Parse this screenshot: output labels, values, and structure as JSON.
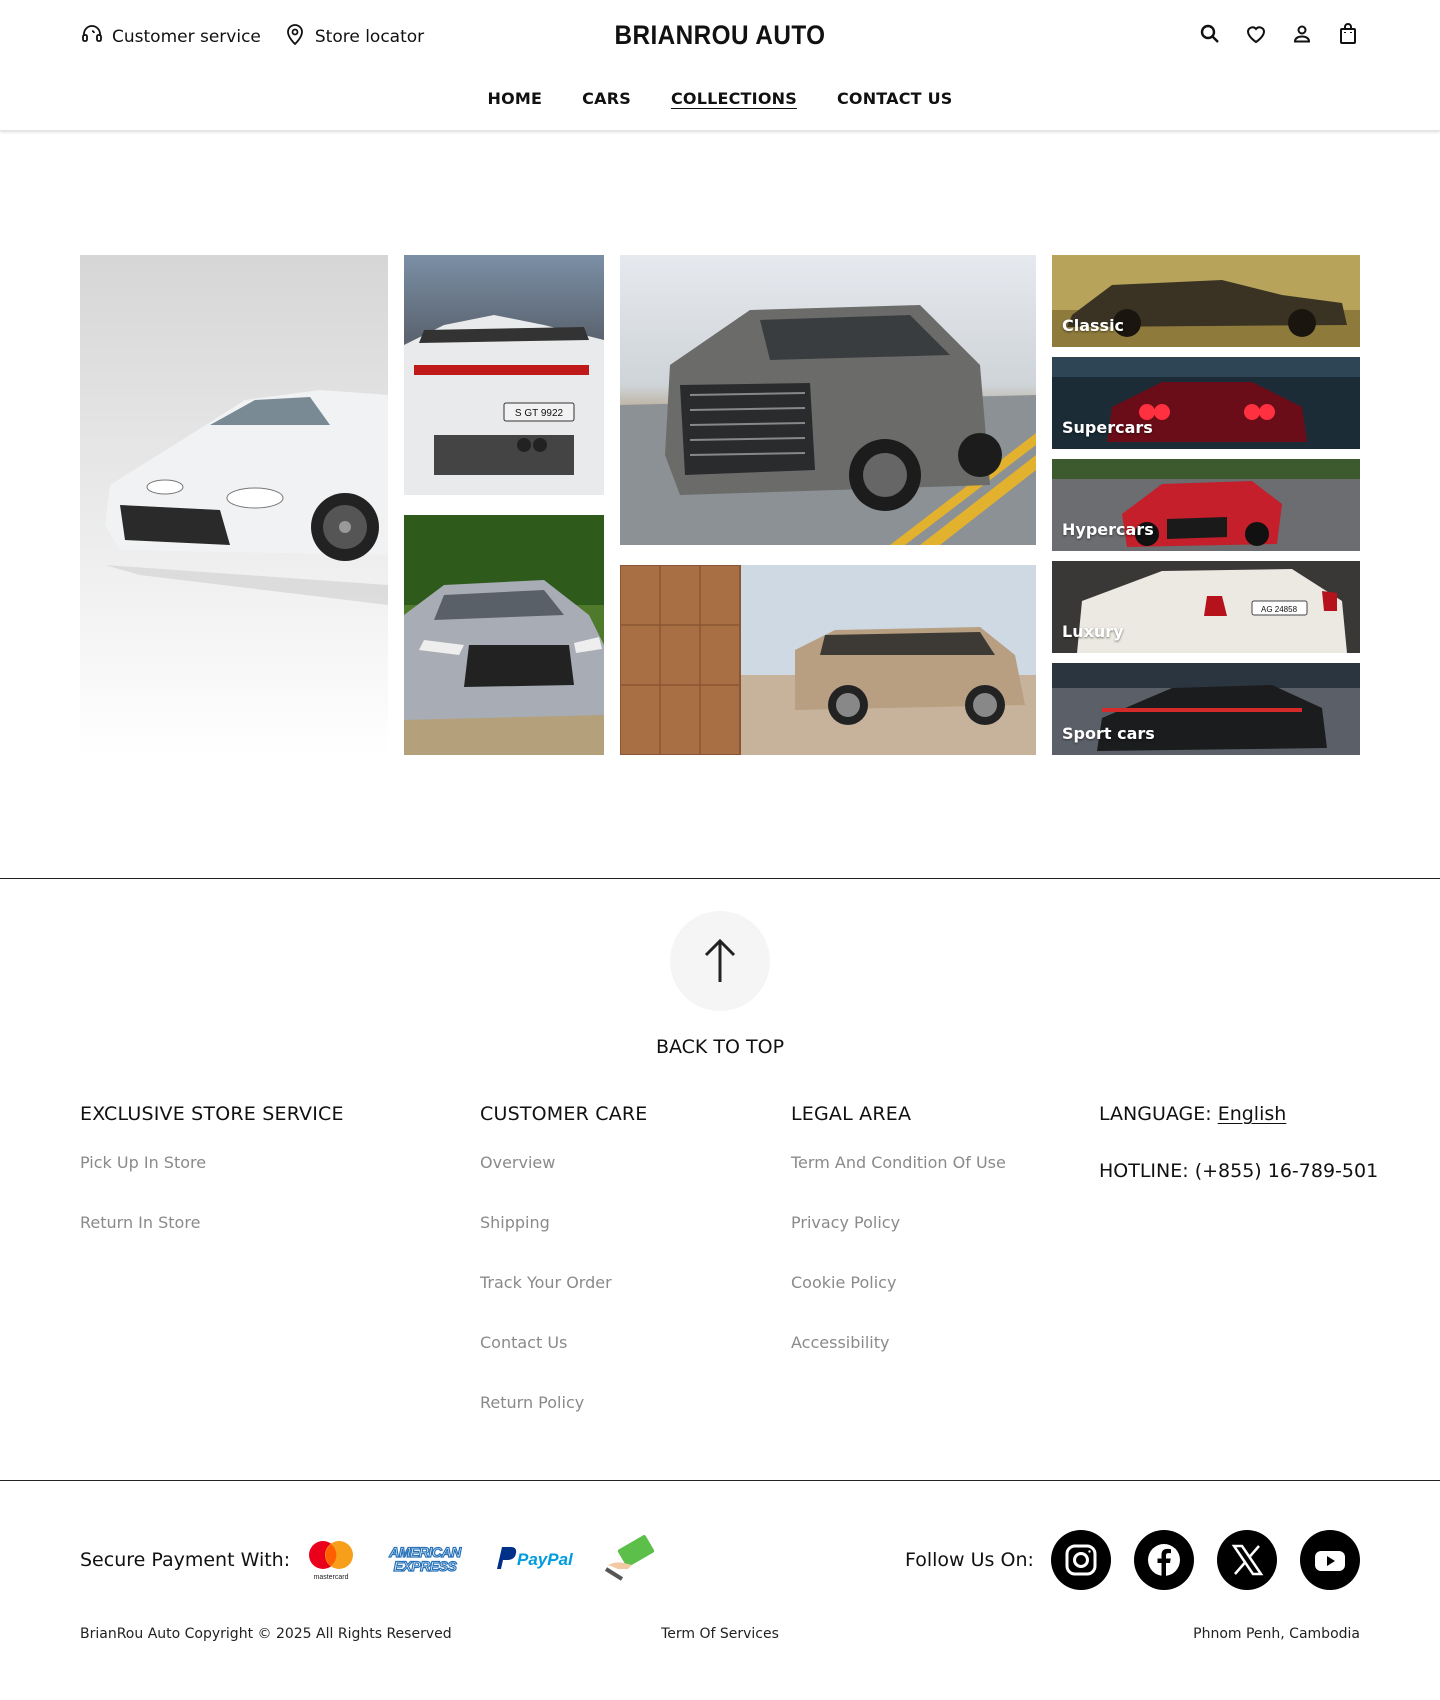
{
  "header": {
    "customer_service": "Customer service",
    "store_locator": "Store locator",
    "logo": "BRIANROU AUTO",
    "icons": [
      "search-icon",
      "heart-icon",
      "user-icon",
      "bag-icon"
    ],
    "nav": [
      {
        "label": "HOME"
      },
      {
        "label": "CARS"
      },
      {
        "label": "COLLECTIONS",
        "active": true
      },
      {
        "label": "CONTACT US"
      }
    ]
  },
  "gallery": {
    "tiles": [
      "white-skyline-gtr",
      "white-porsche-gt3-rear",
      "grey-audi-rs6",
      "grey-lexus-suv",
      "beige-range-rover"
    ],
    "plate": "S GT 9922",
    "plate2": "AG 24858",
    "categories": [
      {
        "label": "Classic"
      },
      {
        "label": "Supercars"
      },
      {
        "label": "Hypercars"
      },
      {
        "label": "Luxury"
      },
      {
        "label": "Sport cars"
      }
    ]
  },
  "footer": {
    "back_to_top": "BACK TO TOP",
    "columns": [
      {
        "title": "EXCLUSIVE STORE SERVICE",
        "links": [
          "Pick Up In Store",
          "Return In Store"
        ]
      },
      {
        "title": "CUSTOMER CARE",
        "links": [
          "Overview",
          "Shipping",
          "Track Your Order",
          "Contact Us",
          "Return Policy"
        ]
      },
      {
        "title": "LEGAL AREA",
        "links": [
          "Term And Condition Of Use",
          "Privacy Policy",
          "Cookie Policy",
          "Accessibility"
        ]
      }
    ],
    "language_label": "LANGUAGE: ",
    "language_value": "English",
    "hotline": "HOTLINE: (+855) 16-789-501",
    "payment_label": "Secure Payment With:",
    "payment_methods": [
      {
        "name": "mastercard",
        "text": "mastercard"
      },
      {
        "name": "american-express",
        "text": "AMERICAN EXPRESS"
      },
      {
        "name": "paypal",
        "text": "PayPal"
      },
      {
        "name": "cash",
        "text": ""
      }
    ],
    "follow_label": "Follow Us On:",
    "social": [
      "instagram-icon",
      "facebook-icon",
      "x-icon",
      "youtube-icon"
    ],
    "copyright": "BrianRou Auto Copyright © 2025  All Rights Reserved",
    "terms": "Term Of Services",
    "location": "Phnom Penh, Cambodia"
  },
  "colors": {
    "text": "#111111",
    "muted_link": "#8a8a8a",
    "back_top_bg": "#f5f5f5"
  }
}
